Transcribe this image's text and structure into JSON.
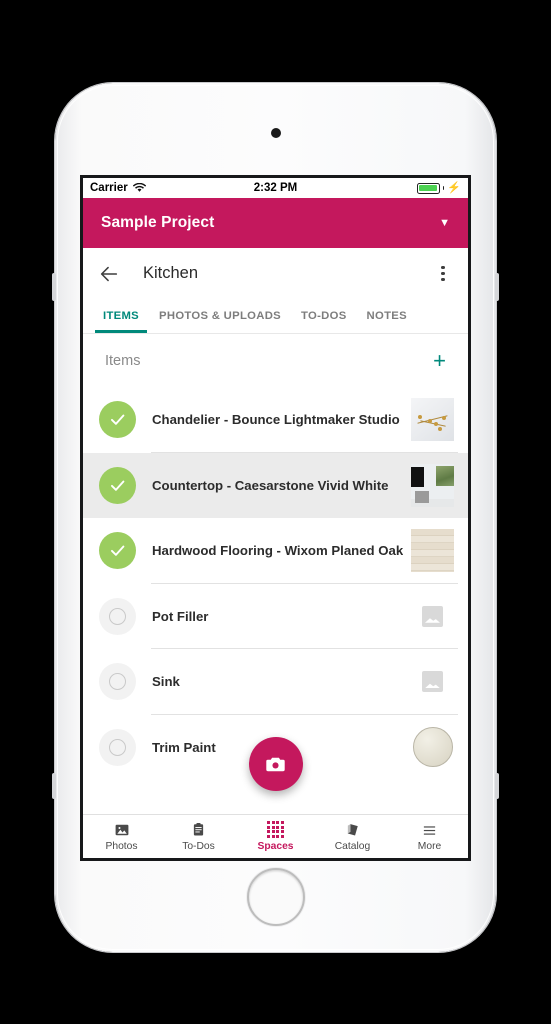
{
  "status_bar": {
    "carrier": "Carrier",
    "wifi_icon": "wifi-icon",
    "time": "2:32 PM",
    "battery_icon": "battery-icon",
    "charging_icon": "lightning-bolt-icon"
  },
  "project_header": {
    "title": "Sample Project",
    "chevron_icon": "chevron-down-icon",
    "background_color": "#C4185D"
  },
  "space_nav": {
    "back_icon": "back-arrow-icon",
    "title": "Kitchen",
    "overflow_icon": "more-vertical-icon"
  },
  "tabs": {
    "active_color": "#00897B",
    "items": [
      {
        "label": "ITEMS",
        "active": true
      },
      {
        "label": "PHOTOS & UPLOADS",
        "active": false
      },
      {
        "label": "TO-DOS",
        "active": false
      },
      {
        "label": "NOTES",
        "active": false
      }
    ]
  },
  "items_section": {
    "title": "Items",
    "add_label": "+",
    "add_icon": "plus-icon",
    "done_color": "#9BCD5F",
    "rows": [
      {
        "label": "Chandelier - Bounce Lightmaker Studio",
        "status": "done",
        "thumb": "chandelier-photo",
        "selected": false
      },
      {
        "label": "Countertop - Caesarstone Vivid White",
        "status": "done",
        "thumb": "countertop-photo",
        "selected": true
      },
      {
        "label": "Hardwood Flooring - Wixom Planed Oak",
        "status": "done",
        "thumb": "wood-floor-photo",
        "selected": false
      },
      {
        "label": "Pot Filler",
        "status": "todo",
        "thumb": "image-placeholder",
        "selected": false
      },
      {
        "label": "Sink",
        "status": "todo",
        "thumb": "image-placeholder",
        "selected": false
      },
      {
        "label": "Trim Paint",
        "status": "todo",
        "thumb": "paint-swatch",
        "selected": false
      }
    ]
  },
  "fab": {
    "icon": "camera-icon",
    "color": "#C4185D"
  },
  "bottom_nav": {
    "active_color": "#C4185D",
    "items": [
      {
        "label": "Photos",
        "icon": "photos-icon",
        "active": false
      },
      {
        "label": "To-Dos",
        "icon": "clipboard-icon",
        "active": false
      },
      {
        "label": "Spaces",
        "icon": "grid-icon",
        "active": true
      },
      {
        "label": "Catalog",
        "icon": "book-icon",
        "active": false
      },
      {
        "label": "More",
        "icon": "hamburger-icon",
        "active": false
      }
    ]
  }
}
